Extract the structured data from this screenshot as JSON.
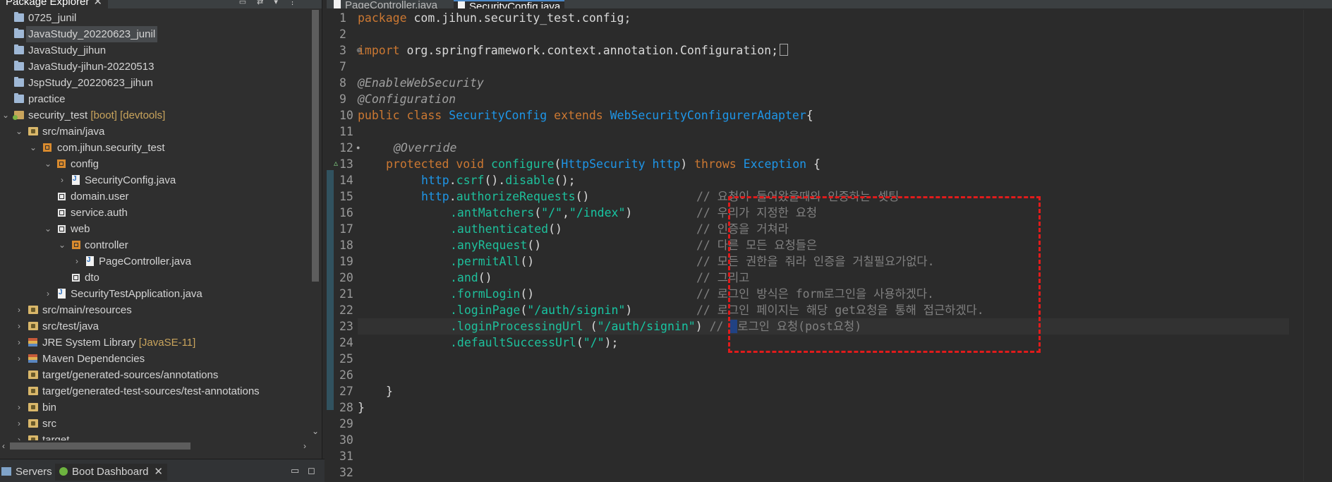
{
  "explorer": {
    "tab_title": "Package Explorer",
    "close_glyph": "✕",
    "toolbar_glyphs": "▭ ⇄ ▾ ⋮",
    "items": [
      {
        "label": "0725_junil",
        "decoration": ""
      },
      {
        "label": "JavaStudy_20220623_junil",
        "decoration": ""
      },
      {
        "label": "JavaStudy_jihun",
        "decoration": ""
      },
      {
        "label": "JavaStudy-jihun-20220513",
        "decoration": ""
      },
      {
        "label": "JspStudy_20220623_jihun",
        "decoration": ""
      },
      {
        "label": "practice",
        "decoration": ""
      },
      {
        "label": "security_test",
        "decoration": "[boot] [devtools]"
      },
      {
        "label": "src/main/java",
        "decoration": ""
      },
      {
        "label": "com.jihun.security_test",
        "decoration": ""
      },
      {
        "label": "config",
        "decoration": ""
      },
      {
        "label": "SecurityConfig.java",
        "decoration": ""
      },
      {
        "label": "domain.user",
        "decoration": ""
      },
      {
        "label": "service.auth",
        "decoration": ""
      },
      {
        "label": "web",
        "decoration": ""
      },
      {
        "label": "controller",
        "decoration": ""
      },
      {
        "label": "PageController.java",
        "decoration": ""
      },
      {
        "label": "dto",
        "decoration": ""
      },
      {
        "label": "SecurityTestApplication.java",
        "decoration": ""
      },
      {
        "label": "src/main/resources",
        "decoration": ""
      },
      {
        "label": "src/test/java",
        "decoration": ""
      },
      {
        "label": "JRE System Library",
        "decoration": "[JavaSE-11]"
      },
      {
        "label": "Maven Dependencies",
        "decoration": ""
      },
      {
        "label": "target/generated-sources/annotations",
        "decoration": ""
      },
      {
        "label": "target/generated-test-sources/test-annotations",
        "decoration": ""
      },
      {
        "label": "bin",
        "decoration": ""
      },
      {
        "label": "src",
        "decoration": ""
      },
      {
        "label": "target",
        "decoration": ""
      }
    ]
  },
  "bottom_panel": {
    "tabs": [
      {
        "label": "Servers"
      },
      {
        "label": "Boot Dashboard"
      }
    ],
    "close_glyph": "✕",
    "minimize_glyph": "▭",
    "maximize_glyph": "◻"
  },
  "editor": {
    "tabs": [
      {
        "label": "PageController.java",
        "active": false
      },
      {
        "label": "SecurityConfig.java",
        "active": true
      }
    ],
    "line_numbers": [
      "1",
      "2",
      "3",
      "7",
      "8",
      "9",
      "10",
      "11",
      "12",
      "13",
      "14",
      "15",
      "16",
      "17",
      "18",
      "19",
      "20",
      "21",
      "22",
      "23",
      "24",
      "25",
      "26",
      "27",
      "28",
      "29",
      "30",
      "31",
      "32"
    ],
    "code": {
      "l1_kw": "package",
      "l1_rest": " com.jihun.security_test.config;",
      "l3_kw": "import",
      "l3_rest": " org.springframework.context.annotation.Configuration;",
      "l8": "@EnableWebSecurity",
      "l9": "@Configuration",
      "l10_kw1": "public class ",
      "l10_cls": "SecurityConfig",
      "l10_kw2": " extends ",
      "l10_sup": "WebSecurityConfigurerAdapter",
      "l10_end": "{",
      "l12": "@Override",
      "l13_kw1": "protected void ",
      "l13_m": "configure",
      "l13_p1": "(",
      "l13_t": "HttpSecurity",
      "l13_v": " http",
      "l13_p2": ") ",
      "l13_kw2": "throws ",
      "l13_ex": "Exception",
      "l13_end": " {",
      "l14_obj": "http",
      "l14_dot": ".",
      "l14_m1": "csrf",
      "l14_p1": "().",
      "l14_m2": "disable",
      "l14_end": "();",
      "l15_obj": "http",
      "l15_dot": ".",
      "l15_m": "authorizeRequests",
      "l15_end": "()",
      "l15_cm": "// 요청이 들어왔을때의 인증하는 셋팅",
      "l16_m": ".antMatchers",
      "l16_p": "(",
      "l16_s1": "\"/\"",
      "l16_c": ",",
      "l16_s2": "\"/index\"",
      "l16_end": ")",
      "l16_cm": "// 우리가 지정한 요청",
      "l17_m": ".authenticated",
      "l17_end": "()",
      "l17_cm": "// 인증을 거쳐라",
      "l18_m": ".anyRequest",
      "l18_end": "()",
      "l18_cm": "// 다른 모든 요청들은",
      "l19_m": ".permitAll",
      "l19_end": "()",
      "l19_cm": "// 모든 권한을 줘라 인증을 거칠필요가없다.",
      "l20_m": ".and",
      "l20_end": "()",
      "l20_cm": "// 그리고",
      "l21_m": ".formLogin",
      "l21_end": "()",
      "l21_cm": "// 로그인 방식은 form로그인을 사용하겠다.",
      "l22_m": ".loginPage",
      "l22_p": "(",
      "l22_s": "\"/auth/signin\"",
      "l22_end": ")",
      "l22_cm": "// 로그인 페이지는 해당 get요청을 통해 접근하겠다.",
      "l23_m": ".loginProcessingUrl",
      "l23_p": " (",
      "l23_s": "\"/auth/signin\"",
      "l23_end": ") ",
      "l23_cm1": "// ",
      "l23_cur": "_",
      "l23_cm2": "로그인 요청(post요청)",
      "l24_m": ".defaultSuccessUrl",
      "l24_p": "(",
      "l24_s": "\"/\"",
      "l24_end": ");",
      "l27": "}",
      "l28": "}"
    },
    "fold_glyph": "⊕",
    "override_glyph": "▵"
  },
  "colors": {
    "keyword": "#cc7832",
    "type": "#1e96e8",
    "method": "#1ec09c",
    "comment": "#808080",
    "annotation_box": "#e01b1b"
  }
}
